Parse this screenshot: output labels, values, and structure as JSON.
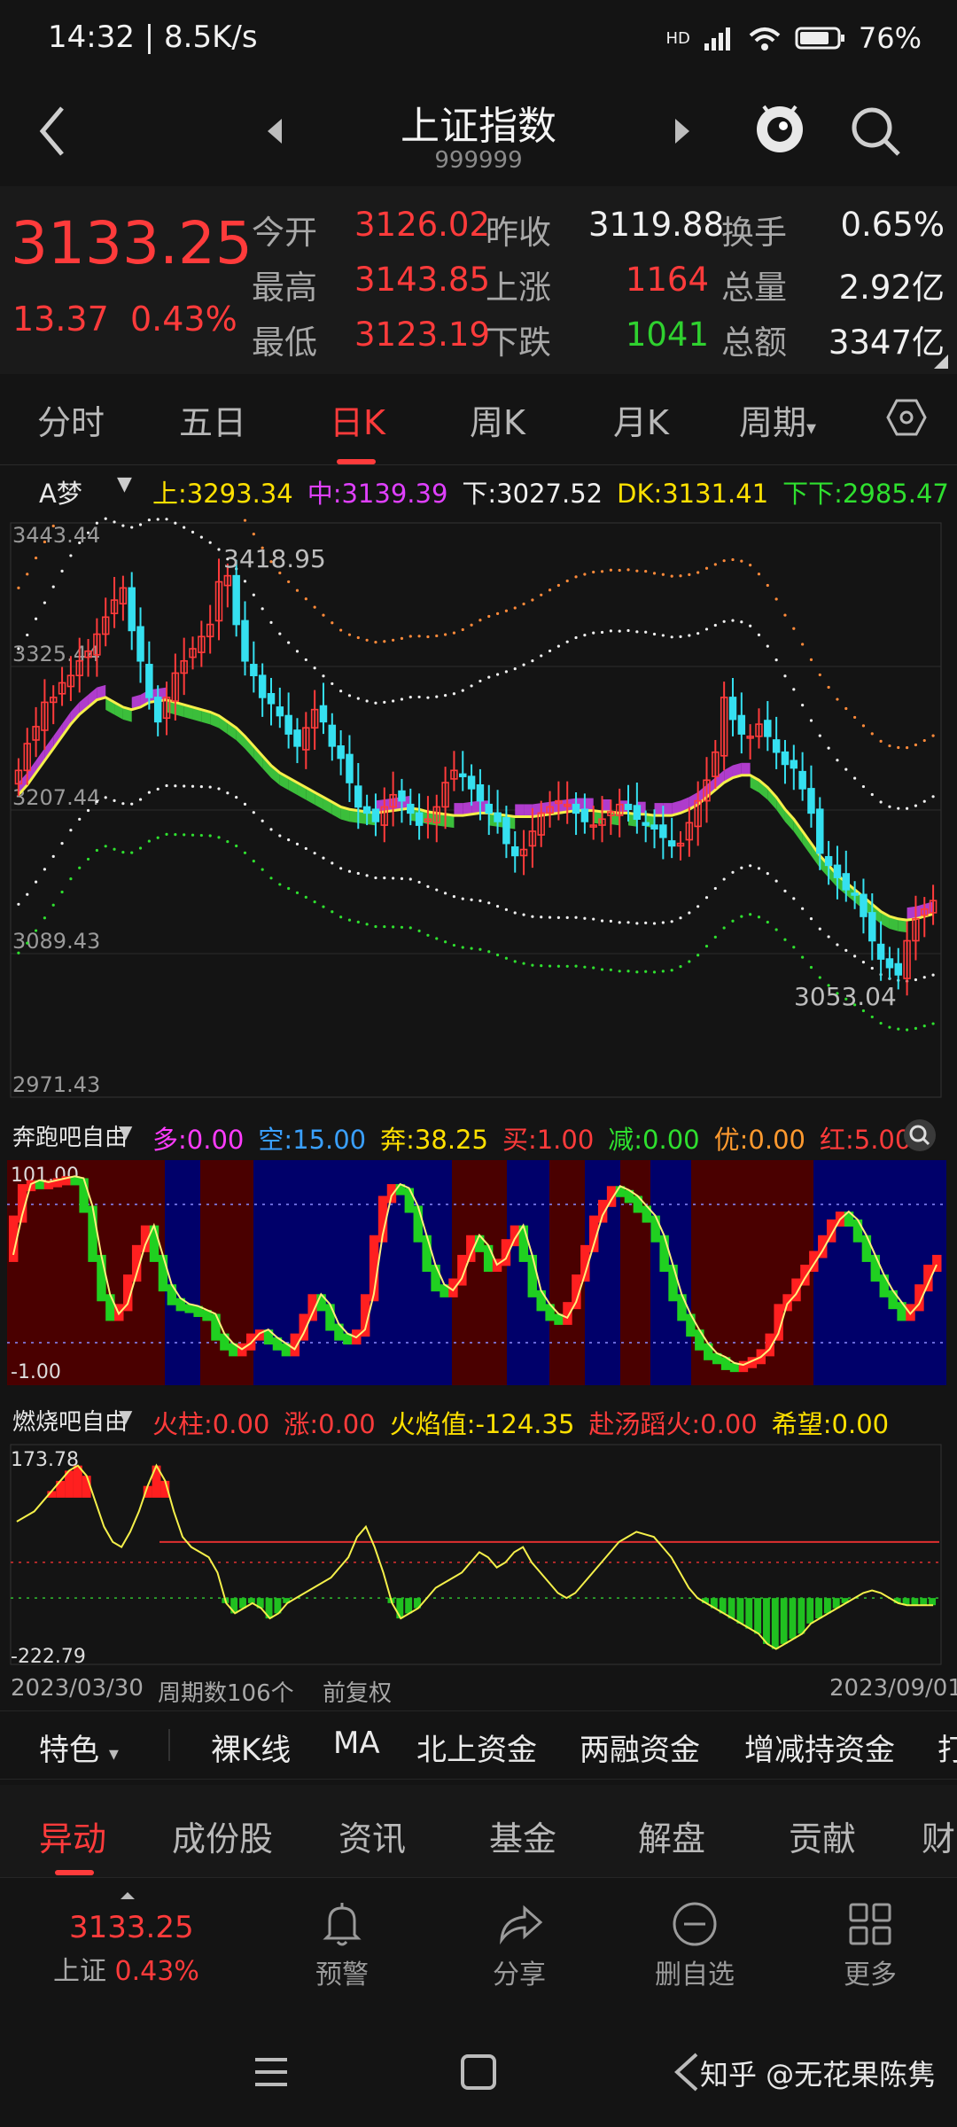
{
  "status_bar": {
    "time": "14:32 | 8.5K/s",
    "network": "HD",
    "battery": "76%"
  },
  "header": {
    "title": "上证指数",
    "code": "999999"
  },
  "quote": {
    "price": "3133.25",
    "change": "13.37",
    "change_pct": "0.43%",
    "rows": [
      {
        "l1": "今开",
        "v1": "3126.02",
        "l2": "昨收",
        "v2": "3119.88",
        "l3": "换手",
        "v3": "0.65%"
      },
      {
        "l1": "最高",
        "v1": "3143.85",
        "l2": "上涨",
        "v2": "1164",
        "l3": "总量",
        "v3": "2.92亿"
      },
      {
        "l1": "最低",
        "v1": "3123.19",
        "l2": "下跌",
        "v2": "1041",
        "l3": "总额",
        "v3": "3347亿"
      }
    ]
  },
  "period_tabs": [
    "分时",
    "五日",
    "日K",
    "周K",
    "月K",
    "周期"
  ],
  "active_period_tab": "日K",
  "main_legend": {
    "name": "A梦",
    "items": [
      {
        "label": "上:",
        "value": "3293.34",
        "color": "#ffe000"
      },
      {
        "label": "中:",
        "value": "3139.39",
        "color": "#e040ff"
      },
      {
        "label": "下:",
        "value": "3027.52",
        "color": "#f0f0f0"
      },
      {
        "label": "DK:",
        "value": "3131.41",
        "color": "#ffe000"
      },
      {
        "label": "下下:",
        "value": "2985.47",
        "color": "#2fe02f"
      }
    ]
  },
  "chart_data": [
    {
      "type": "candlestick",
      "title": "上证指数 日K",
      "y_ticks": [
        "3443.44",
        "3325.44",
        "3207.44",
        "3089.43",
        "2971.43"
      ],
      "ylim": [
        2971.43,
        3443.44
      ],
      "annotations": [
        {
          "text": "3418.95"
        },
        {
          "text": "3053.04"
        }
      ],
      "x_range": [
        "2023/03/30",
        "2023/09/01"
      ],
      "candle_count": 106,
      "closes": [
        3240,
        3262,
        3276,
        3296,
        3300,
        3312,
        3318,
        3330,
        3338,
        3352,
        3366,
        3380,
        3390,
        3355,
        3330,
        3300,
        3280,
        3300,
        3320,
        3330,
        3340,
        3350,
        3360,
        3395,
        3400,
        3360,
        3330,
        3318,
        3300,
        3295,
        3285,
        3270,
        3260,
        3275,
        3290,
        3280,
        3260,
        3250,
        3230,
        3210,
        3205,
        3198,
        3210,
        3220,
        3215,
        3205,
        3195,
        3200,
        3210,
        3230,
        3240,
        3235,
        3225,
        3215,
        3205,
        3198,
        3180,
        3170,
        3175,
        3190,
        3205,
        3210,
        3215,
        3212,
        3205,
        3198,
        3195,
        3200,
        3206,
        3212,
        3208,
        3200,
        3195,
        3192,
        3185,
        3178,
        3180,
        3197,
        3215,
        3232,
        3255,
        3300,
        3282,
        3270,
        3268,
        3278,
        3268,
        3255,
        3245,
        3242,
        3225,
        3205,
        3172,
        3162,
        3152,
        3142,
        3138,
        3120,
        3100,
        3085,
        3078,
        3072,
        3100,
        3118,
        3126,
        3133
      ],
      "dk_line": [
        3220,
        3228,
        3238,
        3248,
        3258,
        3268,
        3278,
        3286,
        3292,
        3298,
        3300,
        3296,
        3292,
        3290,
        3292,
        3296,
        3297,
        3298,
        3296,
        3294,
        3292,
        3290,
        3288,
        3285,
        3280,
        3275,
        3268,
        3260,
        3252,
        3244,
        3238,
        3234,
        3230,
        3226,
        3222,
        3218,
        3214,
        3210,
        3208,
        3207,
        3206,
        3205,
        3206,
        3207,
        3208,
        3209,
        3208,
        3206,
        3205,
        3204,
        3203,
        3203,
        3204,
        3205,
        3205,
        3204,
        3203,
        3202,
        3202,
        3202,
        3203,
        3204,
        3205,
        3206,
        3207,
        3207,
        3207,
        3206,
        3206,
        3205,
        3205,
        3204,
        3204,
        3203,
        3203,
        3203,
        3205,
        3208,
        3212,
        3218,
        3224,
        3230,
        3234,
        3236,
        3236,
        3232,
        3226,
        3218,
        3208,
        3200,
        3190,
        3180,
        3170,
        3162,
        3154,
        3148,
        3142,
        3136,
        3130,
        3124,
        3120,
        3118,
        3117,
        3118,
        3120,
        3122
      ]
    },
    {
      "type": "line",
      "title": "奔跑吧自由",
      "y_ticks": [
        "101.00",
        "-1.00"
      ],
      "ylim": [
        -1,
        101
      ]
    },
    {
      "type": "bar",
      "title": "燃烧吧自由",
      "y_ticks": [
        "173.78",
        "-222.79"
      ],
      "ylim": [
        -222.79,
        173.78
      ]
    }
  ],
  "ind1_legend": {
    "name": "奔跑吧自由",
    "items": [
      {
        "label": "多:",
        "value": "0.00",
        "color": "#ff3cff"
      },
      {
        "label": "空:",
        "value": "15.00",
        "color": "#3aa0ff"
      },
      {
        "label": "奔:",
        "value": "38.25",
        "color": "#ffe000"
      },
      {
        "label": "买:",
        "value": "1.00",
        "color": "#ff3b3b"
      },
      {
        "label": "减:",
        "value": "0.00",
        "color": "#2fe02f"
      },
      {
        "label": "优:",
        "value": "0.00",
        "color": "#ff9a2f"
      },
      {
        "label": "红:",
        "value": "5.00",
        "color": "#ff3b3b"
      }
    ]
  },
  "ind2_legend": {
    "name": "燃烧吧自由",
    "items": [
      {
        "label": "火柱:",
        "value": "0.00",
        "color": "#ff3b3b"
      },
      {
        "label": "涨:",
        "value": "0.00",
        "color": "#ff3b3b"
      },
      {
        "label": "火焰值:",
        "value": "-124.35",
        "color": "#ffe000"
      },
      {
        "label": "赴汤蹈火:",
        "value": "0.00",
        "color": "#ff3b3b"
      },
      {
        "label": "希望:",
        "value": "0.00",
        "color": "#ffe000"
      }
    ]
  },
  "footer_info": {
    "start_date": "2023/03/30",
    "period_count": "周期数106个",
    "adjust": "前复权",
    "end_date": "2023/09/01"
  },
  "features": [
    "特色",
    "裸K线",
    "MA",
    "北上资金",
    "两融资金",
    "增减持资金",
    "打"
  ],
  "bottom_tabs": [
    "异动",
    "成份股",
    "资讯",
    "基金",
    "解盘",
    "贡献",
    "财"
  ],
  "toolbar": {
    "price": "3133.25",
    "index_name": "上证",
    "pct": "0.43%",
    "warn": "预警",
    "share": "分享",
    "remove": "删自选",
    "more": "更多"
  },
  "watermark": "知乎 @无花果陈隽"
}
